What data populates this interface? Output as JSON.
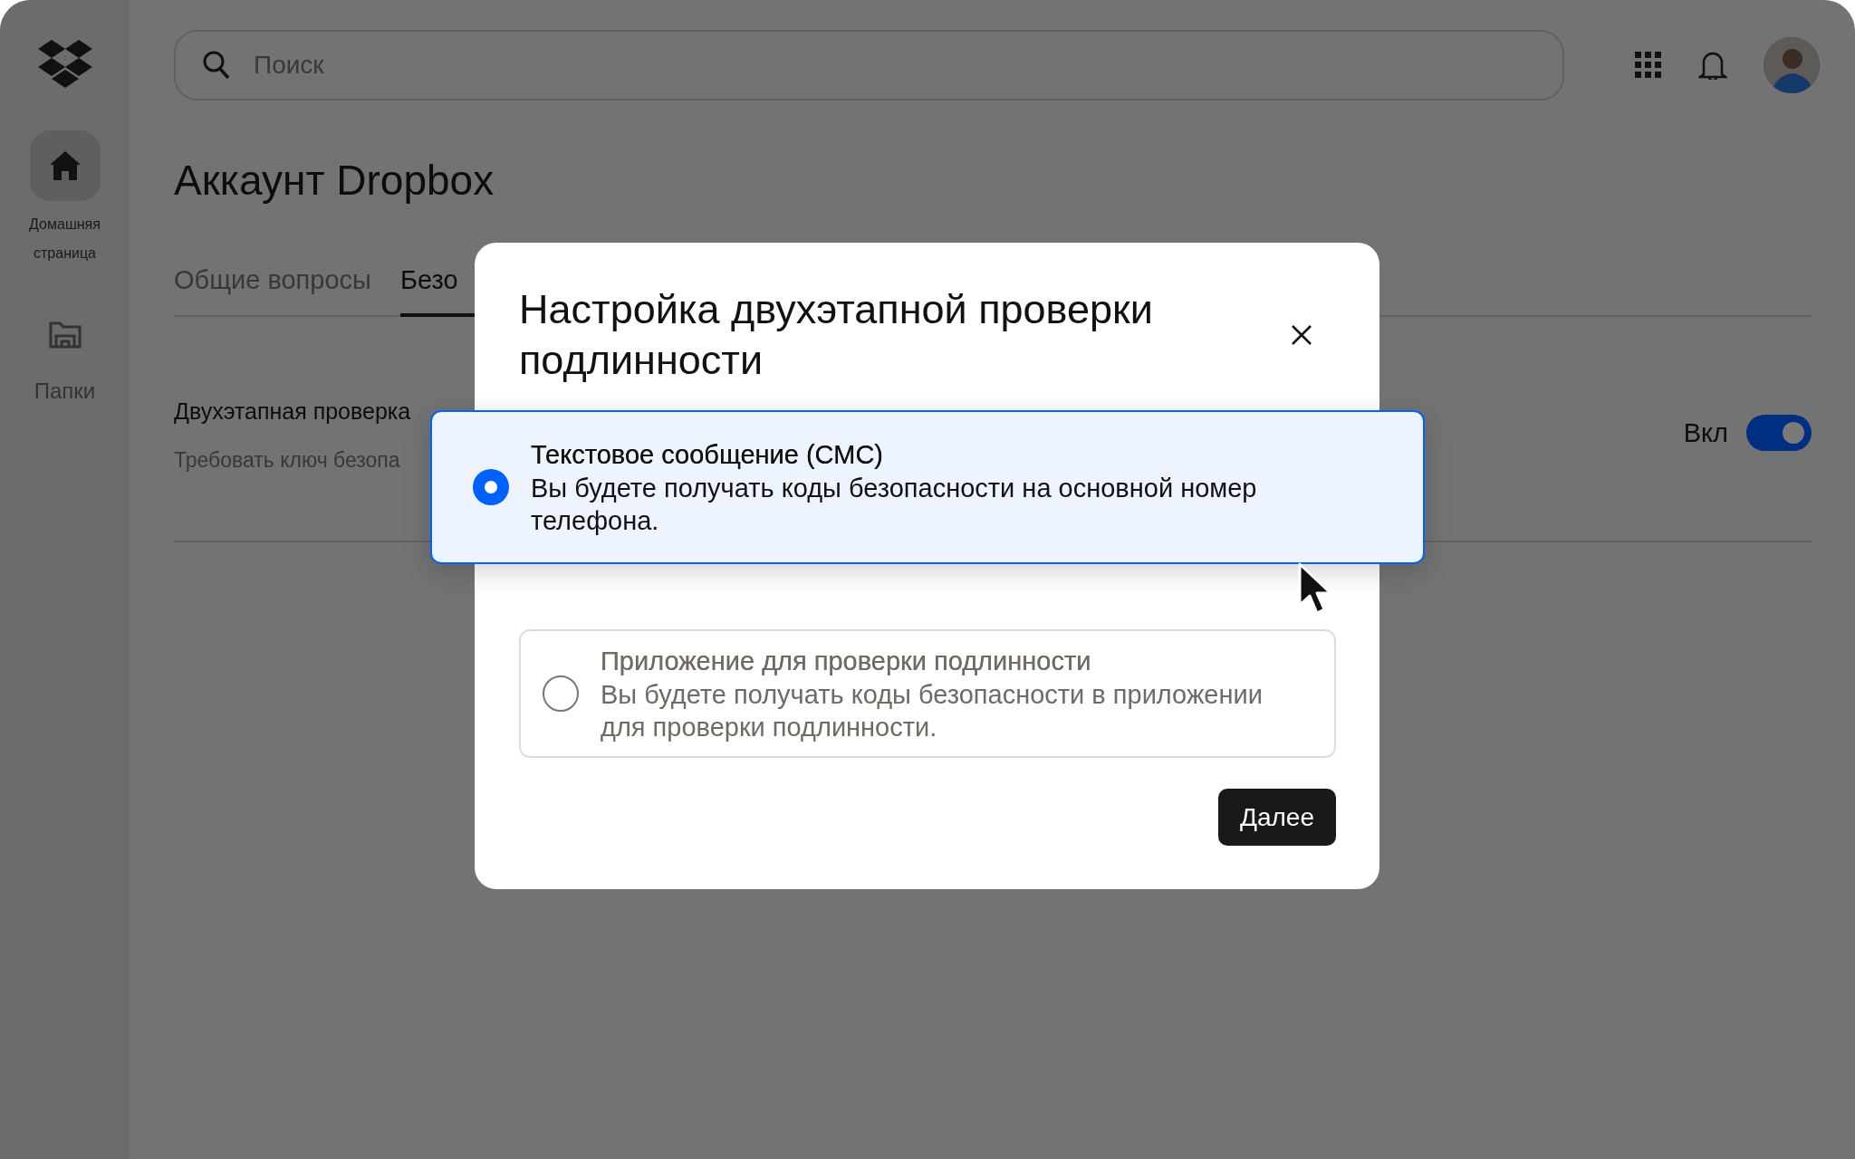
{
  "sidebar": {
    "items": [
      {
        "label": "Домашняя страница",
        "kind": "home",
        "selected": true
      },
      {
        "label": "Папки",
        "kind": "folder",
        "selected": false
      }
    ]
  },
  "search": {
    "placeholder": "Поиск"
  },
  "page": {
    "title": "Аккаунт Dropbox"
  },
  "tabs": [
    {
      "label": "Общие вопросы",
      "selected": false
    },
    {
      "label": "Безо",
      "selected": true
    }
  ],
  "setting": {
    "title": "Двухэтапная проверка",
    "description": "Требовать ключ безопа",
    "toggle": {
      "label": "Вкл",
      "on": true
    }
  },
  "dialog": {
    "title": "Настройка двухэтапной проверки подлинности",
    "options": [
      {
        "title": "Текстовое сообщение (СМС)",
        "description": "Вы будете получать коды безопасности на основной номер телефона.",
        "selected": true
      },
      {
        "title": "Приложение для проверки подлинности",
        "description": "Вы будете получать коды безопасности в приложении для проверки подлинности.",
        "selected": false
      }
    ],
    "button": "Далее"
  }
}
